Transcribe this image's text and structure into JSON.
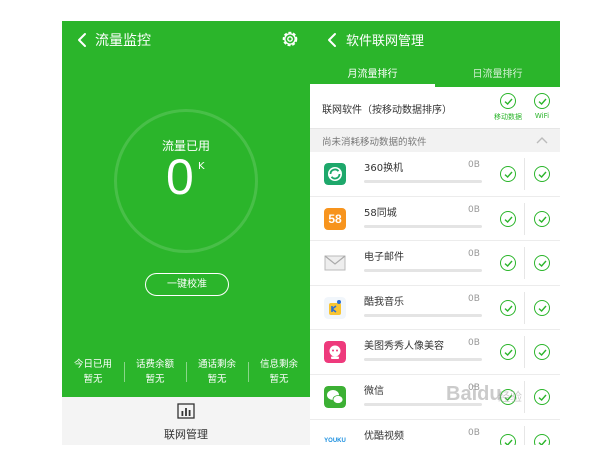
{
  "left": {
    "title": "流量监控",
    "used_label": "流量已用",
    "used_value": "0",
    "used_unit": "K",
    "calibrate_label": "一键校准",
    "stats": [
      {
        "label": "今日已用",
        "value": "暂无"
      },
      {
        "label": "话费余额",
        "value": "暂无"
      },
      {
        "label": "通话剩余",
        "value": "暂无"
      },
      {
        "label": "信息剩余",
        "value": "暂无"
      }
    ],
    "bottom_label": "联网管理"
  },
  "right": {
    "title": "软件联网管理",
    "tabs": [
      {
        "label": "月流量排行",
        "active": true
      },
      {
        "label": "日流量排行",
        "active": false
      }
    ],
    "column_header": {
      "label": "联网软件（按移动数据排序）",
      "mobile_label": "移动数据",
      "wifi_label": "WiFi"
    },
    "section_label": "尚未消耗移动数据的软件",
    "apps": [
      {
        "name": "360换机",
        "size": "0B",
        "icon": "360-switch-icon"
      },
      {
        "name": "58同城",
        "size": "0B",
        "icon": "58-tongcheng-icon",
        "icon_text": "58"
      },
      {
        "name": "电子邮件",
        "size": "0B",
        "icon": "email-icon"
      },
      {
        "name": "酷我音乐",
        "size": "0B",
        "icon": "kuwo-music-icon"
      },
      {
        "name": "美图秀秀人像美容",
        "size": "0B",
        "icon": "meitu-icon"
      },
      {
        "name": "微信",
        "size": "0B",
        "icon": "wechat-icon"
      },
      {
        "name": "优酷视频",
        "size": "0B",
        "icon": "youku-icon",
        "icon_text": "YOUKU"
      }
    ]
  },
  "watermark": {
    "text": "Baidu",
    "sub": "经验"
  },
  "colors": {
    "brand_green": "#2bb52b",
    "text_dark": "#333333",
    "muted": "#999999"
  }
}
